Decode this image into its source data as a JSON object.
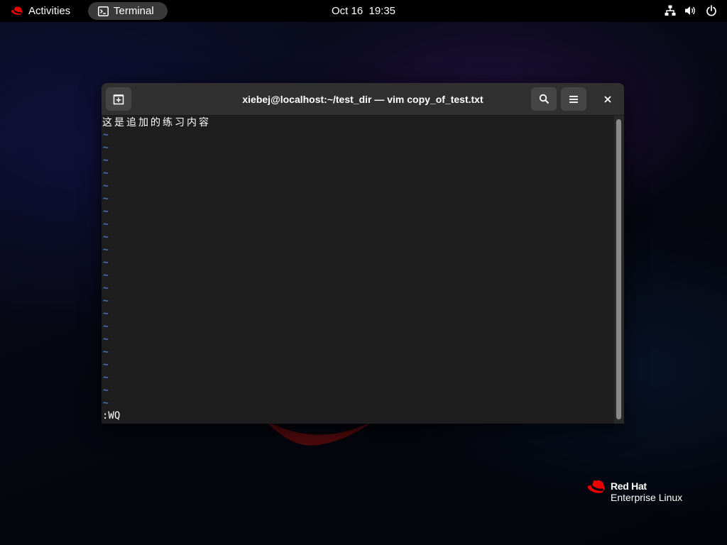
{
  "topbar": {
    "activities_label": "Activities",
    "app_name": "Terminal",
    "clock": "Oct 16  19:35",
    "tray_icons": [
      "network-icon",
      "volume-icon",
      "power-icon"
    ]
  },
  "window": {
    "title": "xiebej@localhost:~/test_dir — vim copy_of_test.txt",
    "buttons": [
      "new-tab-icon",
      "search-icon",
      "menu-icon",
      "close-icon"
    ]
  },
  "editor": {
    "buffer_lines": [
      "这是追加的练习内容"
    ],
    "empty_line_marker": "~",
    "empty_line_count": 22,
    "command_line": ":WQ"
  },
  "branding": {
    "brand": "Red Hat",
    "product": "Enterprise Linux"
  },
  "colors": {
    "accent_red": "#ee0000",
    "tilde_blue": "#3a78c6",
    "terminal_bg": "#1e1e1e",
    "headerbar_bg": "#303030"
  }
}
